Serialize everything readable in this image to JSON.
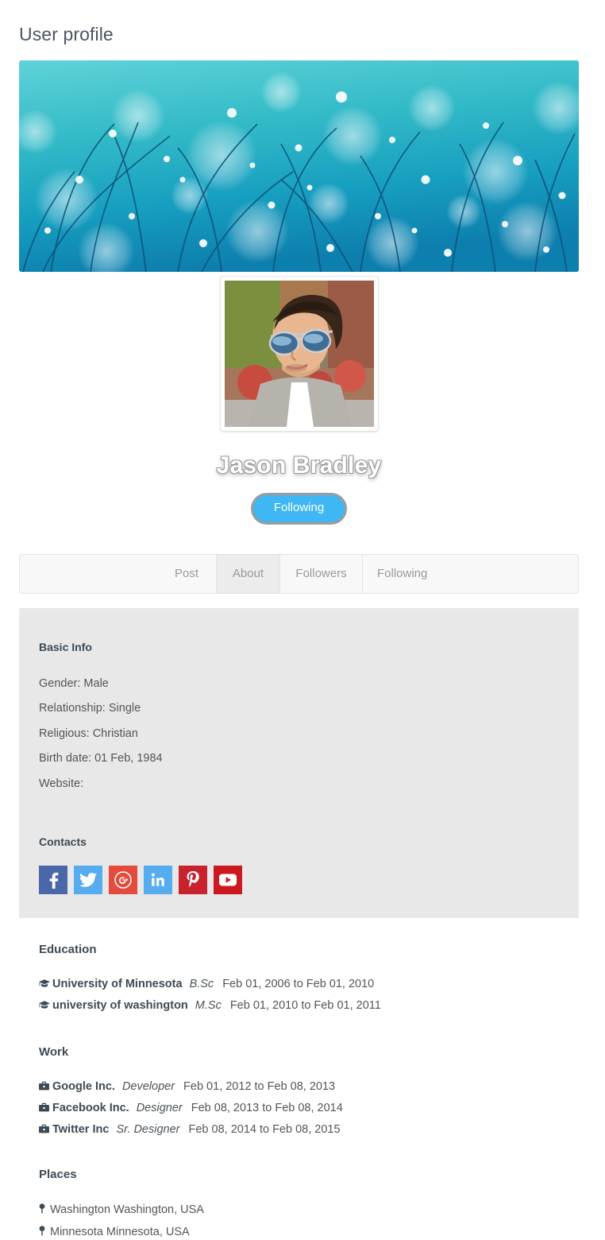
{
  "page": {
    "title": "User profile"
  },
  "cover": {
    "alt": "cover-photo",
    "icon": "cover-photo-image"
  },
  "profile": {
    "avatar_icon": "avatar-photo-image",
    "name": "Jason Bradley",
    "follow_button": "Following",
    "follow_button_color": "#3fb7f4"
  },
  "tabs": [
    {
      "label": "Post",
      "name": "tab-post",
      "active": false
    },
    {
      "label": "About",
      "name": "tab-about",
      "active": true
    },
    {
      "label": "Followers",
      "name": "tab-followers",
      "active": false
    },
    {
      "label": "Following",
      "name": "tab-following",
      "active": false
    }
  ],
  "basic_info": {
    "heading": "Basic Info",
    "lines": [
      "Gender: Male",
      "Relationship: Single",
      "Religious: Christian",
      "Birth date: 01 Feb, 1984",
      "Website:"
    ]
  },
  "contacts": {
    "heading": "Contacts",
    "items": [
      {
        "icon": "facebook-icon",
        "label": "Facebook",
        "color": "#4a68a9"
      },
      {
        "icon": "twitter-icon",
        "label": "Twitter",
        "color": "#55acee"
      },
      {
        "icon": "google-plus-icon",
        "label": "Google Plus",
        "color": "#e54b3c"
      },
      {
        "icon": "linkedin-icon",
        "label": "LinkedIn",
        "color": "#55acee"
      },
      {
        "icon": "pinterest-icon",
        "label": "Pinterest",
        "color": "#c8232c"
      },
      {
        "icon": "youtube-icon",
        "label": "YouTube",
        "color": "#cc181e"
      }
    ]
  },
  "education": {
    "heading": "Education",
    "items": [
      {
        "icon": "graduation-cap-icon",
        "school": "University of Minnesota",
        "degree": "B.Sc",
        "dates": "Feb 01, 2006 to Feb 01, 2010"
      },
      {
        "icon": "graduation-cap-icon",
        "school": "university of washington",
        "degree": "M.Sc",
        "dates": "Feb 01, 2010 to Feb 01, 2011"
      }
    ]
  },
  "work": {
    "heading": "Work",
    "items": [
      {
        "icon": "briefcase-icon",
        "company": "Google Inc.",
        "role": "Developer",
        "dates": "Feb 01, 2012 to Feb 08, 2013"
      },
      {
        "icon": "briefcase-icon",
        "company": "Facebook Inc.",
        "role": "Designer",
        "dates": "Feb 08, 2013 to Feb 08, 2014"
      },
      {
        "icon": "briefcase-icon",
        "company": "Twitter Inc",
        "role": "Sr. Designer",
        "dates": "Feb 08, 2014 to Feb 08, 2015"
      }
    ]
  },
  "places": {
    "heading": "Places",
    "items": [
      {
        "icon": "map-marker-icon",
        "text": "Washington Washington, USA"
      },
      {
        "icon": "map-marker-icon",
        "text": "Minnesota Minnesota, USA"
      }
    ]
  }
}
